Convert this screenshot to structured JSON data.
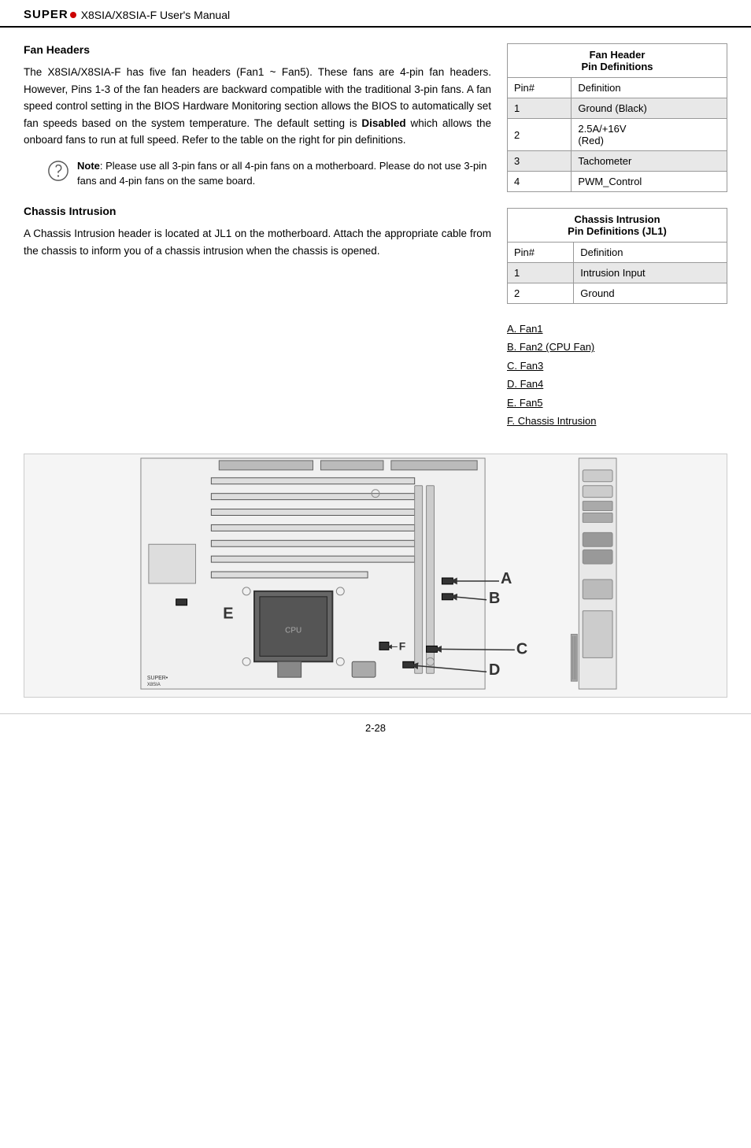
{
  "header": {
    "brand": "SUPER",
    "dot": "●",
    "title": "X8SIA/X8SIA-F User's Manual"
  },
  "fan_headers_section": {
    "heading": "Fan Headers",
    "body1": "The X8SIA/X8SIA-F has five fan headers (Fan1 ~ Fan5). These fans are 4-pin fan headers. However, Pins 1-3 of the fan headers are backward compatible with the traditional 3-pin fans. A fan speed control setting in the BIOS Hardware Monitoring section allows the BIOS to automatically set fan speeds based on the system temperature.  The default setting is ",
    "bold": "Disabled",
    "body2": " which allows the onboard fans to run at full speed. Refer to the table on the right for pin definitions.",
    "note_label": "Note",
    "note_text": ": Please use all 3-pin fans or all 4-pin fans on a motherboard. Please do not use 3-pin fans and 4-pin fans on the same board."
  },
  "fan_header_table": {
    "title_line1": "Fan Header",
    "title_line2": "Pin Definitions",
    "col_pin": "Pin#",
    "col_def": "Definition",
    "rows": [
      {
        "pin": "1",
        "def": "Ground (Black)",
        "shaded": true
      },
      {
        "pin": "2",
        "def": "2.5A/+16V\n(Red)",
        "shaded": false
      },
      {
        "pin": "3",
        "def": "Tachometer",
        "shaded": true
      },
      {
        "pin": "4",
        "def": "PWM_Control",
        "shaded": false
      }
    ]
  },
  "chassis_intrusion_section": {
    "heading": "Chassis Intrusion",
    "body": "A Chassis Intrusion header is located at JL1 on the motherboard. Attach the appropriate cable from the chassis to inform you of a chassis intrusion when the chassis is opened."
  },
  "chassis_table": {
    "title_line1": "Chassis Intrusion",
    "title_line2": "Pin Definitions (JL1)",
    "col_pin": "Pin#",
    "col_def": "Definition",
    "rows": [
      {
        "pin": "1",
        "def": "Intrusion Input",
        "shaded": true
      },
      {
        "pin": "2",
        "def": "Ground",
        "shaded": false
      }
    ]
  },
  "legend": {
    "items": [
      "A. Fan1",
      "B. Fan2 (CPU Fan)",
      "C. Fan3",
      "D. Fan4",
      "E. Fan5",
      "F. Chassis Intrusion"
    ]
  },
  "footer": {
    "page": "2-28"
  }
}
